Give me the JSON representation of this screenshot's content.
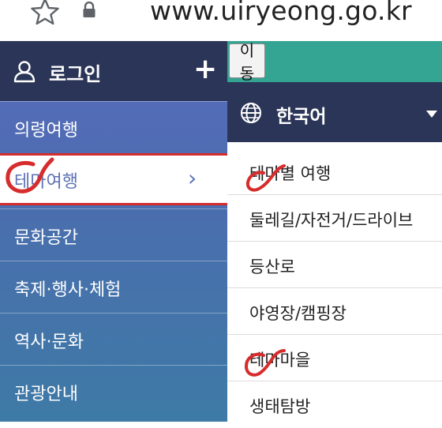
{
  "browser": {
    "url": "www.uiryeong.go.kr",
    "star_icon": "star-outline-icon",
    "lock_icon": "lock-icon"
  },
  "sidebar": {
    "login_label": "로그인",
    "login_icon": "person-icon",
    "expand_icon": "plus-icon",
    "items": [
      {
        "label": "의령여행"
      },
      {
        "label": "테마여행",
        "active": true
      },
      {
        "label": "문화공간"
      },
      {
        "label": "축제·행사·체험"
      },
      {
        "label": "역사·문화"
      },
      {
        "label": "관광안내"
      }
    ]
  },
  "go_button_label": "이동",
  "language": {
    "label": "한국어",
    "icon": "globe-icon"
  },
  "submenu": {
    "items": [
      {
        "label": "테마별 여행"
      },
      {
        "label": "둘레길/자전거/드라이브"
      },
      {
        "label": "등산로"
      },
      {
        "label": "야영장/캠핑장"
      },
      {
        "label": "테마마을"
      },
      {
        "label": "생태탐방"
      }
    ]
  },
  "colors": {
    "header_dark": "#2b3557",
    "menu_blue": "#5a6bbe",
    "teal": "#35a593",
    "annotation_red": "#d62c2c"
  }
}
